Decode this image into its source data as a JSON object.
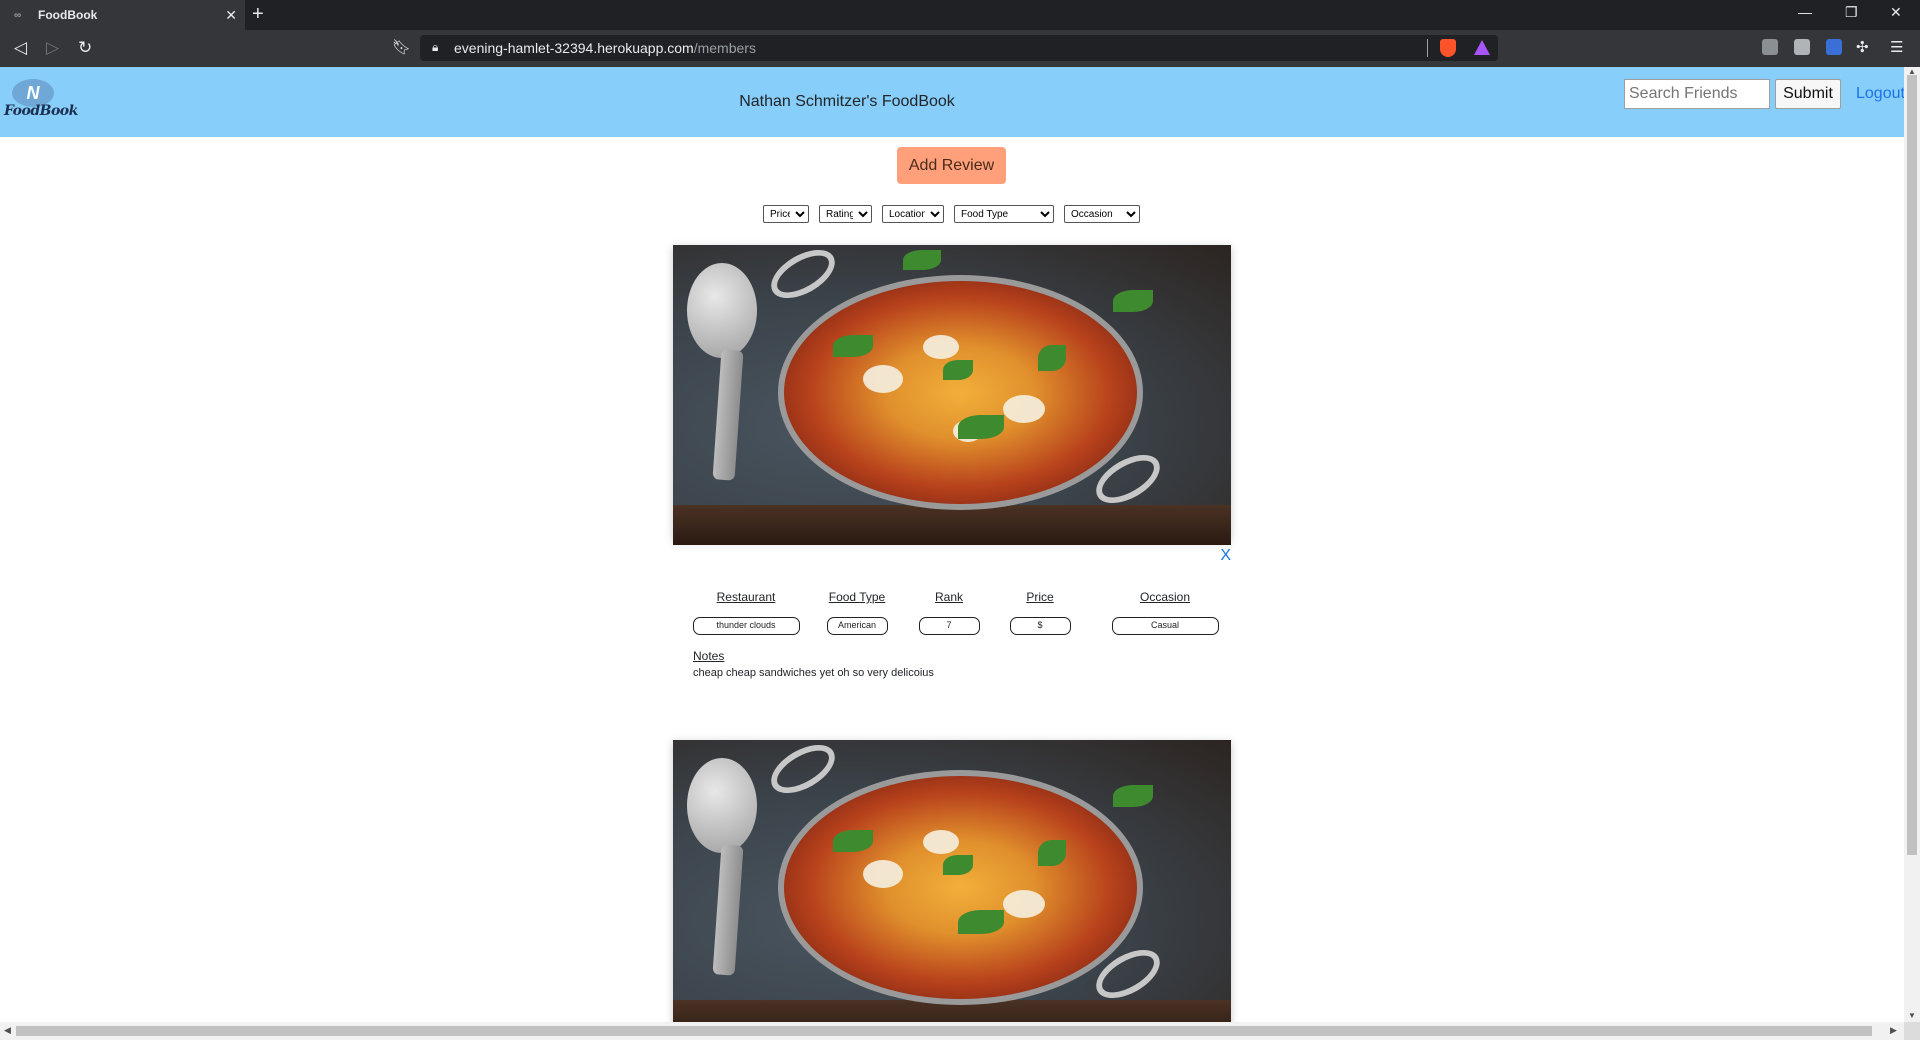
{
  "browser": {
    "tab_title": "FoodBook",
    "tab_close": "✕",
    "new_tab": "+",
    "url_host": "evening-hamlet-32394.herokuapp.com",
    "url_path": "/members"
  },
  "header": {
    "logo_mark": "N",
    "logo_text": "FoodBook",
    "title": "Nathan Schmitzer's FoodBook",
    "search_placeholder": "Search Friends",
    "submit_label": "Submit",
    "logout_label": "Logout"
  },
  "add_review_label": "Add Review",
  "filters": [
    {
      "label": "Price"
    },
    {
      "label": "Rating"
    },
    {
      "label": "Location"
    },
    {
      "label": "Food Type"
    },
    {
      "label": "Occasion"
    }
  ],
  "review": {
    "close_label": "X",
    "fields": [
      {
        "label": "Restaurant",
        "value": "thunder clouds"
      },
      {
        "label": "Food Type",
        "value": "American"
      },
      {
        "label": "Rank",
        "value": "7"
      },
      {
        "label": "Price",
        "value": "$"
      },
      {
        "label": "Occasion",
        "value": "Casual"
      }
    ],
    "notes_label": "Notes",
    "notes_text": "cheap cheap sandwiches yet oh so very delicoius"
  },
  "colors": {
    "header_bg": "#87cefa",
    "add_review_bg": "#ffa07a",
    "link": "#1a73e8"
  }
}
